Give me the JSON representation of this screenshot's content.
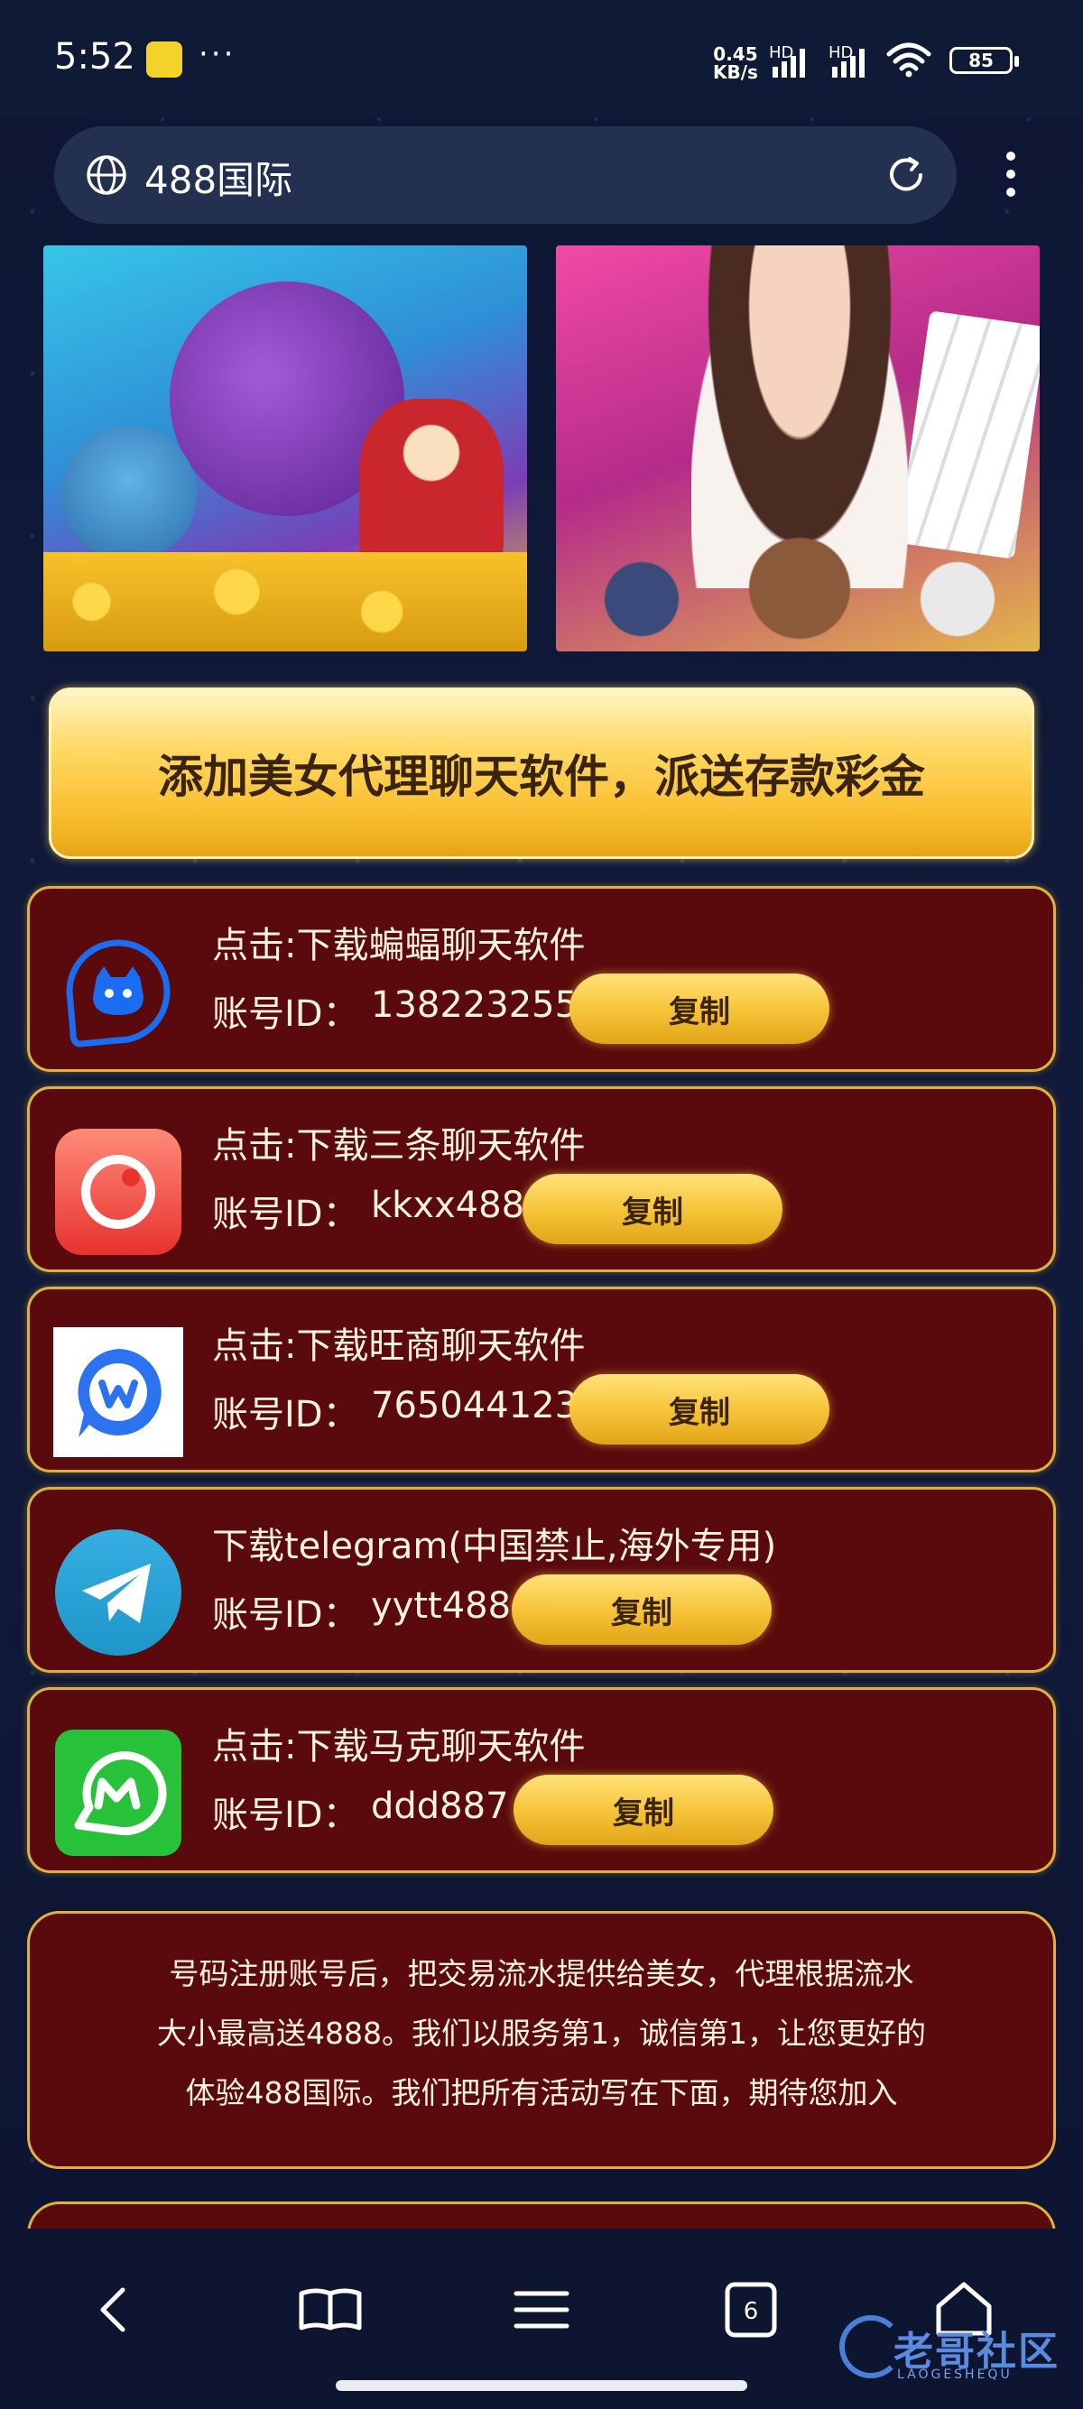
{
  "status_bar": {
    "time": "5:52",
    "overflow": "···",
    "net_speed_value": "0.45",
    "net_speed_unit": "KB/s",
    "signal1_label": "HD",
    "signal2_label": "HD",
    "battery": "85"
  },
  "browser": {
    "site_title": "488国际",
    "tab_count": "6"
  },
  "headline": "添加美女代理聊天软件，派送存款彩金",
  "apps": [
    {
      "title": "点击:下载蝙蝠聊天软件",
      "acct_label": "账号ID：",
      "acct_value": "138223255",
      "copy_label": "复制",
      "icon_color": "#1a6df0"
    },
    {
      "title": "点击:下载三条聊天软件",
      "acct_label": "账号ID：",
      "acct_value": "kkxx488",
      "copy_label": "复制",
      "icon_color": "#f0504a"
    },
    {
      "title": "点击:下载旺商聊天软件",
      "acct_label": "账号ID：",
      "acct_value": "765044123",
      "copy_label": "复制",
      "icon_color": "#2b73f0"
    },
    {
      "title": "下载telegram(中国禁止,海外专用)",
      "acct_label": "账号ID：",
      "acct_value": "yytt488",
      "copy_label": "复制",
      "icon_color": "#2aa3df"
    },
    {
      "title": "点击:下载马克聊天软件",
      "acct_label": "账号ID：",
      "acct_value": "ddd887",
      "copy_label": "复制",
      "icon_color": "#27c23a"
    }
  ],
  "info_lines": [
    "号码注册账号后，把交易流水提供给美女，代理根据流水",
    "大小最高送4888。我们以服务第1，诚信第1，让您更好的",
    "体验488国际。我们把所有活动写在下面，期待您加入"
  ],
  "watermark": {
    "text": "老哥社区",
    "sub": "LAOGESHEQU"
  },
  "colors": {
    "gold": "#e0b23a",
    "card_bg": "#5a0a0c",
    "page_bg": "#0e1630"
  }
}
